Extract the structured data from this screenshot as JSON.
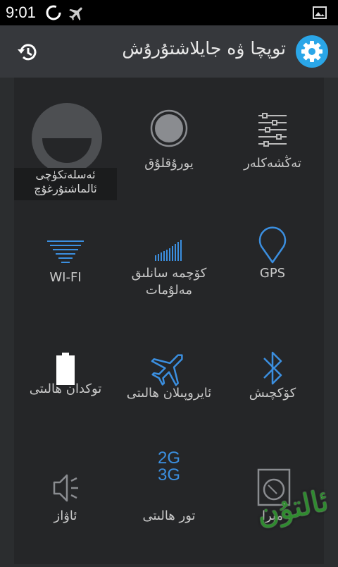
{
  "status_bar": {
    "time": "9:01",
    "icons": [
      "sync-icon",
      "airplane-mode-icon",
      "image-icon"
    ]
  },
  "header": {
    "title": "توپچا ۋە جايلاشتۇرۇش",
    "icons": [
      "reset-icon",
      "gear-icon"
    ],
    "accent_color": "#2aa6e8"
  },
  "tiles": [
    {
      "label": "تەڭشەكلەر",
      "icon": "sliders-icon"
    },
    {
      "label": "يورۇقلۇق",
      "icon": "brightness-icon"
    },
    {
      "label": "ئەسلەتكۈچى ئالماشتۇرغۇچ",
      "icon": "restore-icon"
    },
    {
      "label": "GPS",
      "icon": "location-pin-icon"
    },
    {
      "label": "كۆچمە سانلىق مەلۇمات",
      "icon": "mobile-data-icon"
    },
    {
      "label": "WI-FI",
      "icon": "wifi-icon"
    },
    {
      "label": "كۆكچىش",
      "icon": "bluetooth-icon"
    },
    {
      "label": "ئايروپىلان ھالىتى",
      "icon": "airplane-icon"
    },
    {
      "label": "توكدان ھالىتى",
      "icon": "battery-icon"
    },
    {
      "label": "مېرا",
      "icon": "camera-icon"
    },
    {
      "label": "تور ھالىتى",
      "icon": "network-2g3g-icon",
      "icon_text": [
        "2G",
        "3G"
      ]
    },
    {
      "label": "ئاۋاز",
      "icon": "volume-icon"
    }
  ],
  "watermark": {
    "text": "ئالتۇن"
  }
}
